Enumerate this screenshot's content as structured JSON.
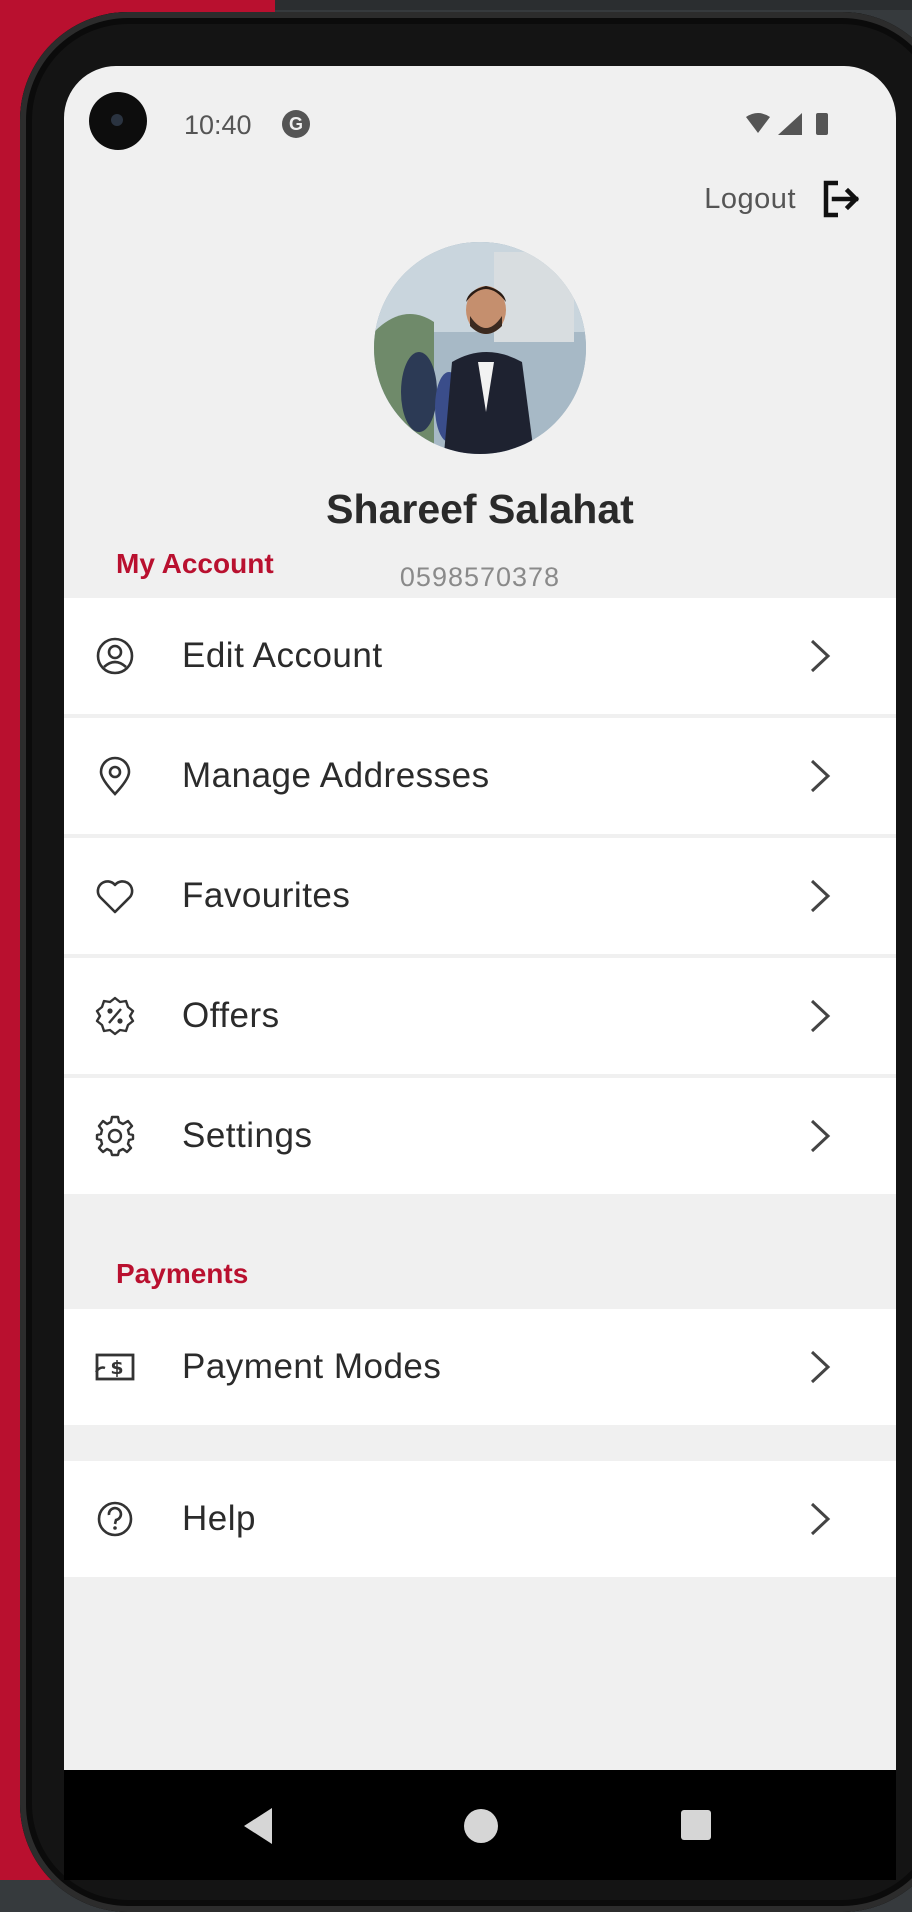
{
  "status_bar": {
    "time": "10:40",
    "notification_letter": "G"
  },
  "header": {
    "logout_label": "Logout"
  },
  "profile": {
    "name": "Shareef Salahat",
    "phone": "0598570378"
  },
  "sections": {
    "account_title": "My Account",
    "payments_title": "Payments"
  },
  "account_items": [
    {
      "label": "Edit Account",
      "icon": "user-circle-icon"
    },
    {
      "label": "Manage Addresses",
      "icon": "location-pin-icon"
    },
    {
      "label": "Favourites",
      "icon": "heart-icon"
    },
    {
      "label": "Offers",
      "icon": "discount-badge-icon"
    },
    {
      "label": "Settings",
      "icon": "gear-icon"
    }
  ],
  "payment_items": [
    {
      "label": "Payment Modes",
      "icon": "cash-icon"
    }
  ],
  "other_items": [
    {
      "label": "Help",
      "icon": "help-circle-icon"
    }
  ],
  "colors": {
    "accent": "#b9102f",
    "background": "#f0f0f0",
    "text": "#2b2b2b"
  }
}
